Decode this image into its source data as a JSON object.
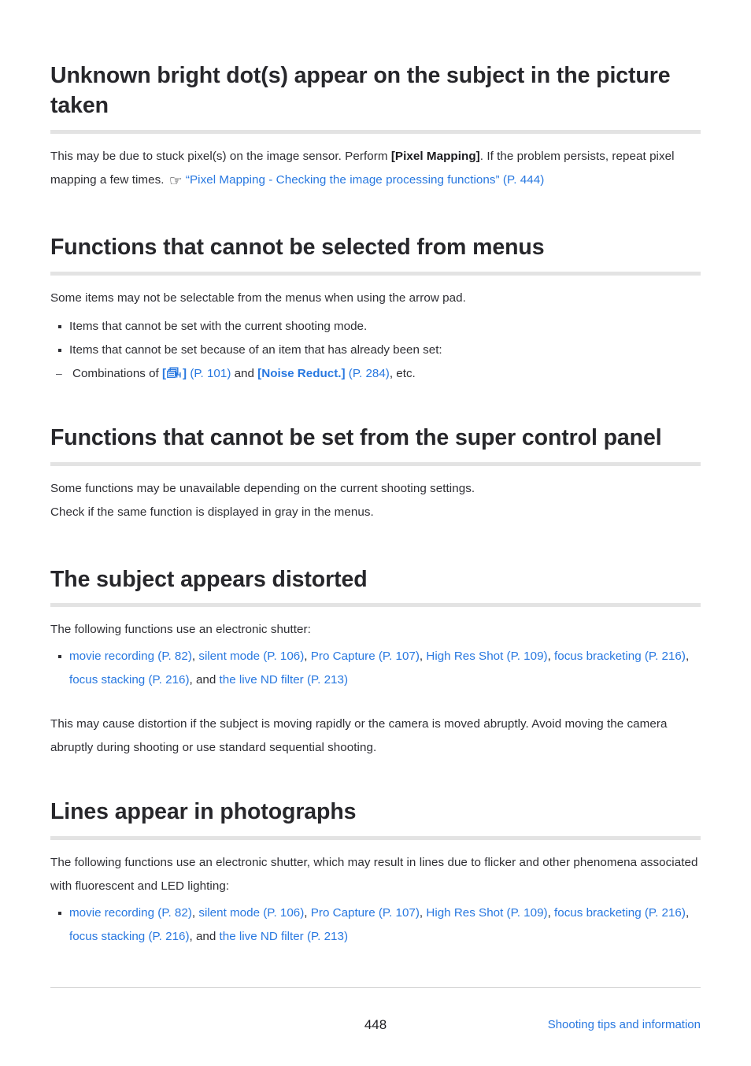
{
  "page": {
    "number": "448",
    "footer_link": "Shooting tips and information"
  },
  "sections": [
    {
      "id": "bright-dots",
      "heading": "Unknown bright dot(s) appear on the subject in the picture taken",
      "para": {
        "t1": "This may be due to stuck pixel(s) on the image sensor. Perform ",
        "b1": "[Pixel Mapping]",
        "t2": ". If the problem persists, repeat pixel mapping a few times. ",
        "icon": "pointing-hand-icon",
        "icon_glyph": "☞",
        "link": "“Pixel Mapping - Checking the image processing functions” (P. 444)"
      }
    },
    {
      "id": "functions-not-selectable-menus",
      "heading": "Functions that cannot be selected from menus",
      "intro": "Some items may not be selectable from the menus when using the arrow pad.",
      "bullets": [
        "Items that cannot be set with the current shooting mode.",
        "Items that cannot be set because of an item that has already been set:"
      ],
      "sub_bullet": {
        "t1": "Combinations of ",
        "bracket_open": "[",
        "icon": "sequential-shooting-high-icon",
        "bracket_close": "]",
        "page_ref_1": " (P. 101)",
        "t2": " and ",
        "bold_link": "[Noise Reduct.]",
        "page_ref_2": " (P. 284)",
        "t3": ", etc."
      }
    },
    {
      "id": "functions-not-set-super-control-panel",
      "heading": "Functions that cannot be set from the super control panel",
      "lines": [
        "Some functions may be unavailable depending on the current shooting settings.",
        "Check if the same function is displayed in gray in the menus."
      ]
    },
    {
      "id": "subject-distorted",
      "heading": "The subject appears distorted",
      "intro": "The following functions use an electronic shutter:",
      "bullet_links": {
        "l1": "movie recording (P. 82)",
        "s1": ", ",
        "l2": "silent mode (P. 106)",
        "s2": ", ",
        "l3": "Pro Capture (P. 107)",
        "s3": ", ",
        "l4": "High Res Shot (P. 109)",
        "s4": ", ",
        "l5": "focus bracketing (P. 216)",
        "s5": ", ",
        "l6": "focus stacking (P. 216)",
        "s6": ", and ",
        "l7": "the live ND filter (P. 213)"
      },
      "outro": "This may cause distortion if the subject is moving rapidly or the camera is moved abruptly. Avoid moving the camera abruptly during shooting or use standard sequential shooting."
    },
    {
      "id": "lines-in-photographs",
      "heading": "Lines appear in photographs",
      "intro": "The following functions use an electronic shutter, which may result in lines due to flicker and other phenomena associated with fluorescent and LED lighting:",
      "bullet_links": {
        "l1": "movie recording (P. 82)",
        "s1": ", ",
        "l2": "silent mode (P. 106)",
        "s2": ", ",
        "l3": "Pro Capture (P. 107)",
        "s3": ", ",
        "l4": "High Res Shot (P. 109)",
        "s4": ", ",
        "l5": "focus bracketing (P. 216)",
        "s5": ", ",
        "l6": "focus stacking (P. 216)",
        "s6": ", and ",
        "l7": "the live ND filter (P. 213)"
      }
    }
  ],
  "colors": {
    "link": "#2878e0",
    "heading": "#27272b",
    "body": "#2e2e33",
    "rule": "#e3e3e3"
  }
}
